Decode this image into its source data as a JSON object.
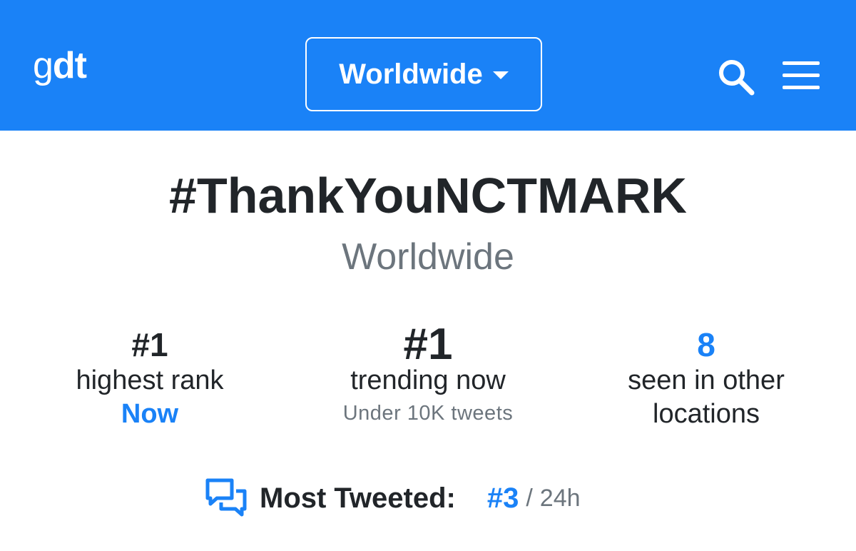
{
  "header": {
    "logo_light": "g",
    "logo_bold": "dt",
    "location_label": "Worldwide",
    "icons": [
      "search-icon",
      "menu-icon",
      "chevron-down-icon"
    ],
    "accent_color": "#1a82f7"
  },
  "trend": {
    "hashtag": "#ThankYouNCTMARK",
    "region": "Worldwide"
  },
  "stats": {
    "highest_rank": {
      "value": "#1",
      "label": "highest rank",
      "when": "Now"
    },
    "trending_now": {
      "value": "#1",
      "label": "trending now",
      "note": "Under 10K tweets"
    },
    "other_locations": {
      "value": "8",
      "label_line1": "seen in other",
      "label_line2": "locations"
    }
  },
  "most_tweeted": {
    "icon": "chat-bubbles-icon",
    "label": "Most Tweeted:",
    "rank": "#3",
    "separator": "/",
    "period": "24h"
  }
}
